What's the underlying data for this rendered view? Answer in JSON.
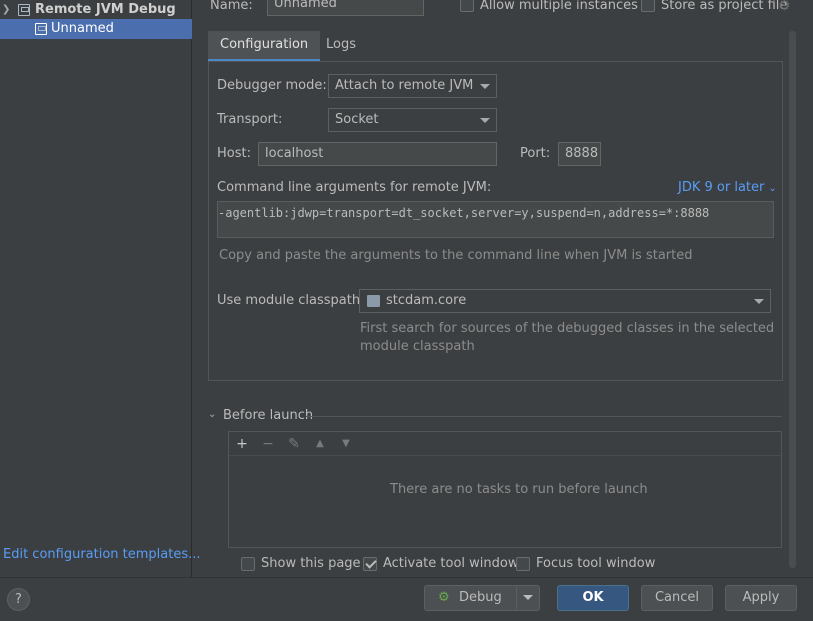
{
  "tree": {
    "group_label": "Remote JVM Debug",
    "item_label": "Unnamed"
  },
  "left_footer": {
    "link": "Edit configuration templates..."
  },
  "header": {
    "name_label": "Name:",
    "name_value": "Unnamed",
    "allow_multiple_label": "Allow multiple instances",
    "store_as_file_label": "Store as project file"
  },
  "tabs": [
    {
      "label": "Configuration",
      "active": true
    },
    {
      "label": "Logs",
      "active": false
    }
  ],
  "config": {
    "debugger_mode_label": "Debugger mode:",
    "debugger_mode_value": "Attach to remote JVM",
    "transport_label": "Transport:",
    "transport_value": "Socket",
    "host_label": "Host:",
    "host_value": "localhost",
    "port_label": "Port:",
    "port_value": "8888",
    "cmd_args_label": "Command line arguments for remote JVM:",
    "jdk_link": "JDK 9 or later",
    "cmd_args_value": "-agentlib:jdwp=transport=dt_socket,server=y,suspend=n,address=*:8888",
    "cmd_hint": "Copy and paste the arguments to the command line when JVM is started",
    "module_label": "Use module classpath:",
    "module_value": "stcdam.core",
    "module_hint_1": "First search for sources of the debugged classes in the selected",
    "module_hint_2": "module classpath"
  },
  "before_launch": {
    "title": "Before launch",
    "empty_text": "There are no tasks to run before launch",
    "toolbar": [
      "+",
      "−",
      "✎",
      "▲",
      "▼"
    ]
  },
  "options": {
    "show_page_label": "Show this page",
    "show_page_checked": false,
    "activate_tool_label": "Activate tool window",
    "activate_tool_checked": true,
    "focus_tool_label": "Focus tool window",
    "focus_tool_checked": false
  },
  "footer": {
    "help": "?",
    "debug_label": "Debug",
    "ok_label": "OK",
    "cancel_label": "Cancel",
    "apply_label": "Apply"
  },
  "colors": {
    "background": "#3c3f41",
    "selection": "#4b6eaf",
    "link": "#589df6",
    "primary_button": "#365880"
  }
}
